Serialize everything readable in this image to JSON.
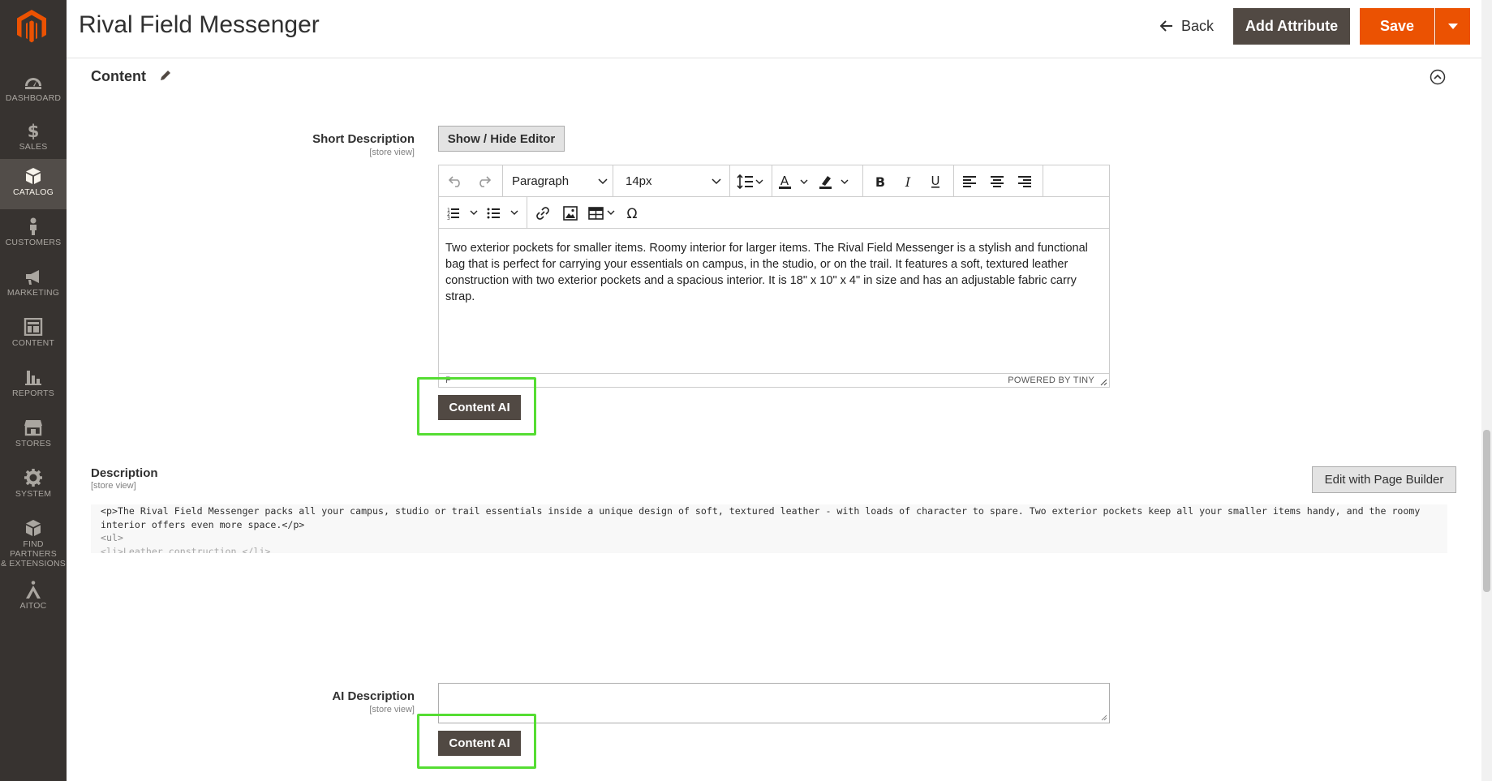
{
  "header": {
    "title": "Rival Field Messenger",
    "back_label": "Back",
    "add_attribute_label": "Add Attribute",
    "save_label": "Save"
  },
  "sidebar": {
    "items": [
      {
        "label": "DASHBOARD",
        "icon": "dashboard-icon"
      },
      {
        "label": "SALES",
        "icon": "dollar-icon"
      },
      {
        "label": "CATALOG",
        "icon": "box-icon",
        "active": true
      },
      {
        "label": "CUSTOMERS",
        "icon": "person-icon"
      },
      {
        "label": "MARKETING",
        "icon": "megaphone-icon"
      },
      {
        "label": "CONTENT",
        "icon": "layout-icon"
      },
      {
        "label": "REPORTS",
        "icon": "bar-chart-icon"
      },
      {
        "label": "STORES",
        "icon": "store-icon"
      },
      {
        "label": "SYSTEM",
        "icon": "gear-icon"
      },
      {
        "label": "FIND PARTNERS",
        "label2": "& EXTENSIONS",
        "icon": "partners-icon"
      },
      {
        "label": "AITOC",
        "icon": "aitoc-icon"
      }
    ]
  },
  "section": {
    "title": "Content"
  },
  "short_description": {
    "label": "Short Description",
    "scope": "[store view]",
    "toggle_label": "Show / Hide Editor",
    "format_select": "Paragraph",
    "size_select": "14px",
    "body": "Two exterior pockets for smaller items. Roomy interior for larger items. The Rival Field Messenger is a stylish and functional bag that is perfect for carrying your essentials on campus, in the studio, or on the trail. It features a soft, textured leather construction with two exterior pockets and a spacious interior. It is 18\" x 10\" x 4\" in size and has an adjustable fabric carry strap.",
    "status_path": "P",
    "powered_by": "POWERED BY TINY",
    "ai_button": "Content AI"
  },
  "description": {
    "label": "Description",
    "scope": "[store view]",
    "page_builder_label": "Edit with Page Builder",
    "code_line1": "<p>The Rival Field Messenger packs all your campus, studio or trail essentials inside a unique design of soft, textured leather - with loads of character to spare. Two exterior pockets keep all your smaller items handy, and the roomy interior offers even more space.</p>",
    "code_line2": "<ul>",
    "code_line3": "<li>Leather construction.</li>"
  },
  "ai_description": {
    "label": "AI Description",
    "scope": "[store view]",
    "value": "",
    "ai_button": "Content AI"
  },
  "colors": {
    "sidebar_bg": "#373330",
    "accent_orange": "#eb5202",
    "dark_button": "#514943",
    "highlight_green": "#55dd33"
  }
}
